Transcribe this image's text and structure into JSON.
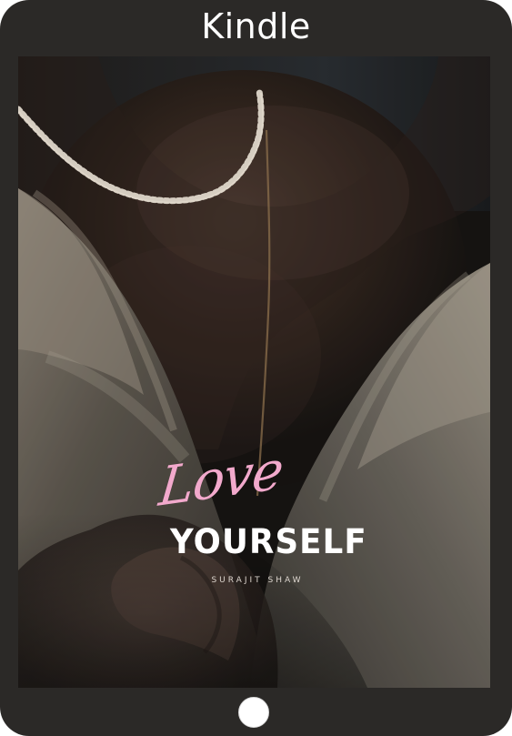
{
  "device": {
    "title": "Kindle",
    "frame_color": "#2b2927",
    "title_color": "#ffffff"
  },
  "book": {
    "title_script": "Love",
    "title_main": "YOURSELF",
    "author": "SURAJIT SHAW"
  },
  "colors": {
    "script_pink": "#f2a9cc",
    "cover_white": "#ffffff",
    "author_gray": "#ddd6cf",
    "home_button": "#ffffff"
  },
  "icons": {
    "home_button": "home-button-icon"
  }
}
